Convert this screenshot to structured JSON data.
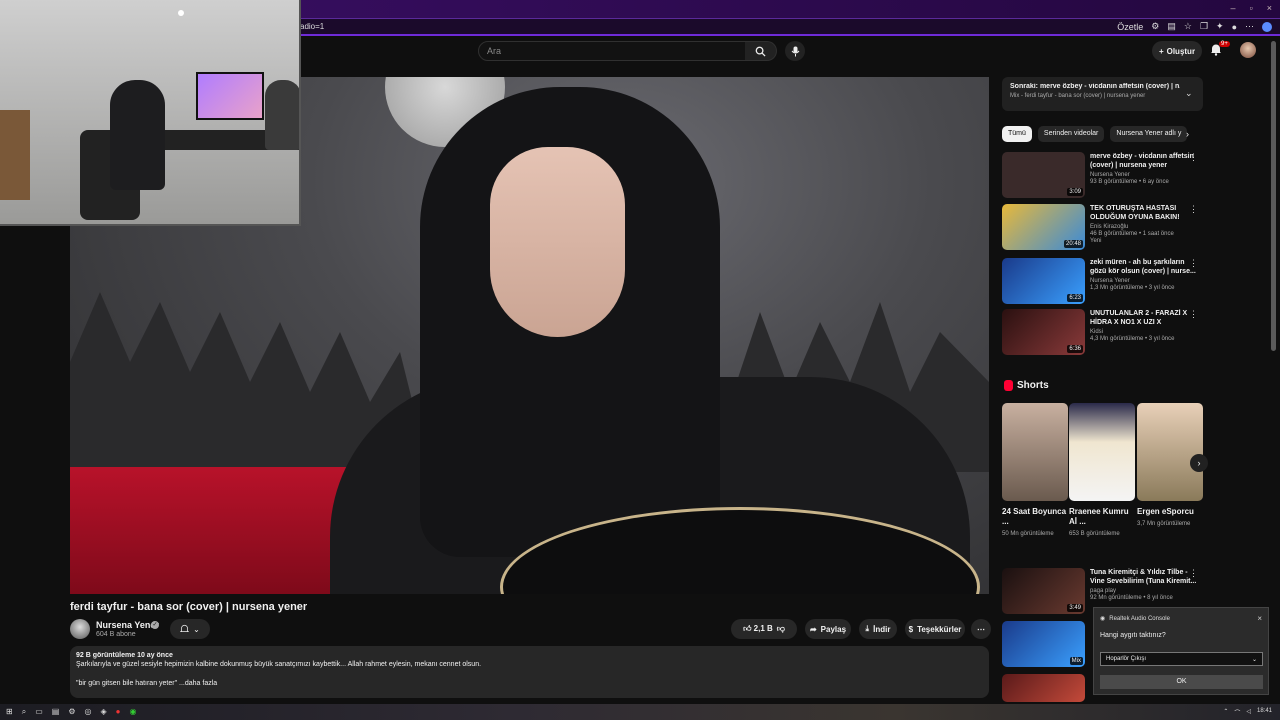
{
  "browser": {
    "url_fragment": "adio=1",
    "summarize_label": "Özetle",
    "window_controls": [
      "–",
      "▫",
      "×"
    ]
  },
  "header": {
    "search_placeholder": "Ara",
    "create_label": "Oluştur",
    "notification_count": "9+"
  },
  "video": {
    "title": "ferdi tayfur - bana sor (cover) | nursena yener",
    "channel": "Nursena Yener",
    "subscribers": "604 B abone",
    "likes": "2,1 B",
    "share_label": "Paylaş",
    "download_label": "İndir",
    "thanks_label": "Teşekkürler",
    "description": {
      "meta": "92 B görüntüleme  10 ay önce",
      "text": "Şarkılarıyla ve güzel sesiyle hepimizin kalbine dokunmuş büyük sanatçımızı kaybettik... Allah rahmet eylesin, mekanı cennet olsun.",
      "quote": "\"bir gün gitsen bile hatıran yeter\" ...daha fazla"
    }
  },
  "sidebar": {
    "up_next": {
      "title": "Sonraki: merve özbey - vicdanın affetsin (cover) | n...",
      "subtitle": "Mix - ferdi tayfur - bana sor (cover) | nursena yener"
    },
    "chips": [
      "Tümü",
      "Serinden videolar",
      "Nursena Yener adlı y"
    ],
    "recommendations": [
      {
        "title": "merve özbey - vicdanın affetsin (cover) | nursena yener",
        "channel": "Nursena Yener",
        "stats": "93 B görüntüleme • 6 ay önce",
        "duration": "3:09",
        "thumb": "#3a2a2a"
      },
      {
        "title": "TEK OTURUŞTA HASTASI OLDUĞUM OYUNA BAKIN!",
        "channel": "Enis Kirazoğlu",
        "stats": "46 B görüntüleme • 1 saat önce",
        "extra": "Yeni",
        "duration": "20:48",
        "thumb": "#c9a23a"
      },
      {
        "title": "zeki müren - ah bu şarkıların gözü kör olsun (cover) | nurse...",
        "channel": "Nursena Yener",
        "stats": "1,3 Mn görüntüleme • 3 yıl önce",
        "duration": "6:23",
        "thumb": "#2a6ad8"
      },
      {
        "title": "UNUTULANLAR 2 - FARAZİ X HİDRA X NO1 X UZI X DEFKHA...",
        "channel": "Kidsi",
        "stats": "4,3 Mn görüntüleme • 3 yıl önce",
        "duration": "6:36",
        "thumb": "#5a2a2a"
      }
    ],
    "shorts_title": "Shorts",
    "shorts": [
      {
        "title": "24 Saat Boyunca ...",
        "views": "50 Mn görüntüleme",
        "thumb": "#a08a78"
      },
      {
        "title": "Rraenee Kumru Aİ ...",
        "views": "653 B görüntüleme",
        "thumb": "#e3d2b0"
      },
      {
        "title": "Ergen eSporcu",
        "views": "3,7 Mn görüntüleme",
        "thumb": "#c4a888"
      }
    ],
    "more_recs": [
      {
        "title": "Tuna Kiremitçi & Yıldız Tilbe - Vine Sevebilirim (Tuna Kiremit...",
        "channel": "paga play",
        "stats": "92 Mn görüntüleme • 8 yıl önce",
        "duration": "3:49",
        "thumb": "#3a2a26"
      },
      {
        "title": "",
        "channel": "",
        "stats": "",
        "duration": "Mix",
        "thumb": "#1e5ad0"
      }
    ]
  },
  "popup": {
    "app": "Realtek Audio Console",
    "question": "Hangi aygıtı taktınız?",
    "selected": "Hoparlör Çıkışı",
    "ok": "OK"
  },
  "taskbar": {
    "time": "18:41"
  },
  "colors": {
    "accent": "#6f2bd8",
    "youtube_red": "#ff0033",
    "background": "#0f0f0f"
  }
}
